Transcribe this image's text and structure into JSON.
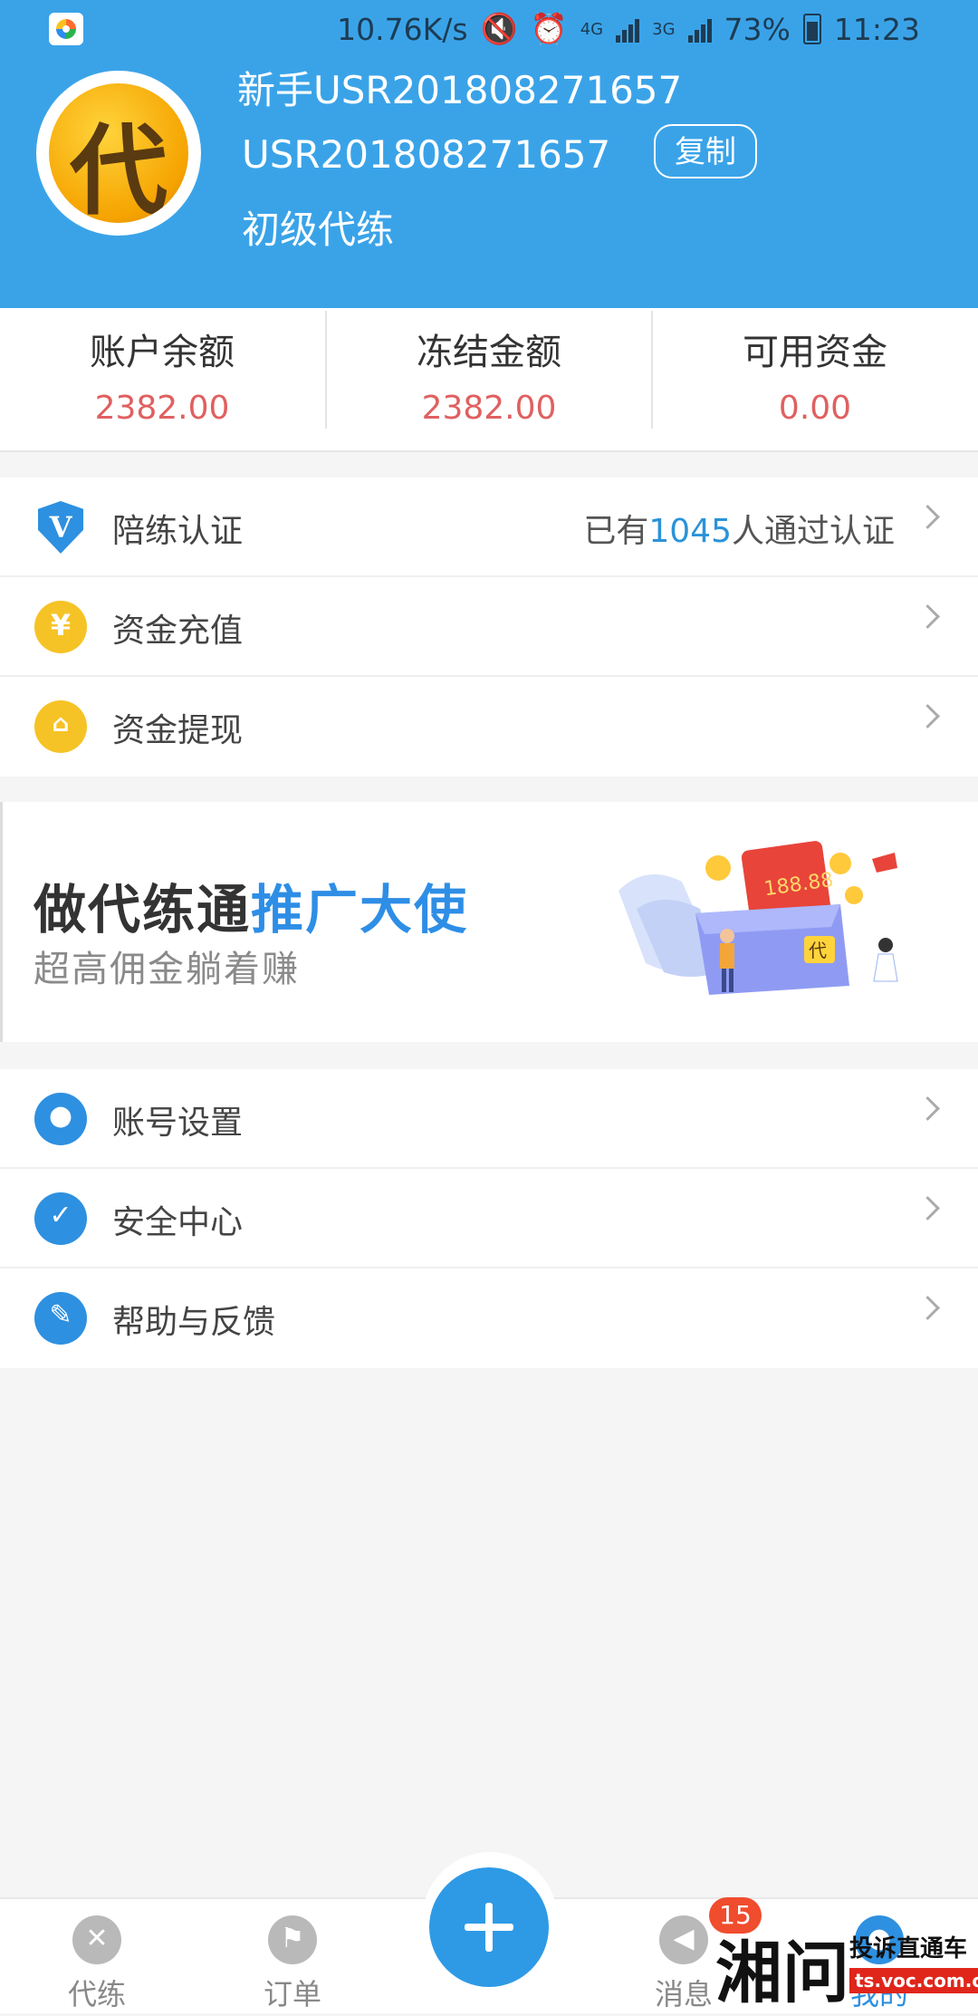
{
  "status_bar": {
    "speed": "10.76K/s",
    "net1": "4G",
    "net2": "3G",
    "battery": "73%",
    "time": "11:23"
  },
  "profile": {
    "name": "新手USR201808271657",
    "id": "USR201808271657",
    "copy_label": "复制",
    "level": "初级代练",
    "avatar_char": "代"
  },
  "balances": [
    {
      "label": "账户余额",
      "value": "2382.00"
    },
    {
      "label": "冻结金额",
      "value": "2382.00"
    },
    {
      "label": "可用资金",
      "value": "0.00"
    }
  ],
  "menu1": [
    {
      "label": "陪练认证",
      "icon": "verified-shield-icon",
      "extra_prefix": "已有",
      "extra_count": "1045",
      "extra_suffix": "人通过认证"
    },
    {
      "label": "资金充值",
      "icon": "yuan-coin-icon"
    },
    {
      "label": "资金提现",
      "icon": "home-yuan-icon"
    }
  ],
  "banner": {
    "title_dark": "做代练通",
    "title_blue": "推广大使",
    "subtitle": "超高佣金躺着赚",
    "amount": "188.88",
    "logo_char": "代"
  },
  "menu2": [
    {
      "label": "账号设置",
      "icon": "user-icon"
    },
    {
      "label": "安全中心",
      "icon": "shield-check-icon"
    },
    {
      "label": "帮助与反馈",
      "icon": "edit-icon"
    }
  ],
  "bottom_nav": [
    {
      "label": "代练",
      "icon": "swords-icon"
    },
    {
      "label": "订单",
      "icon": "flag-icon"
    },
    {
      "label": "消息",
      "icon": "speaker-icon",
      "badge": "15"
    },
    {
      "label": "我的",
      "icon": "user-icon",
      "active": true
    }
  ],
  "watermark": {
    "big": "湘问",
    "line1": "投诉直通车",
    "line2": "ts.voc.com.cn"
  },
  "colors": {
    "primary": "#3aa3e8",
    "accent_blue": "#2e90e0",
    "money_red": "#e06060",
    "badge_red": "#f04c2e",
    "icon_yellow": "#f6c326"
  }
}
